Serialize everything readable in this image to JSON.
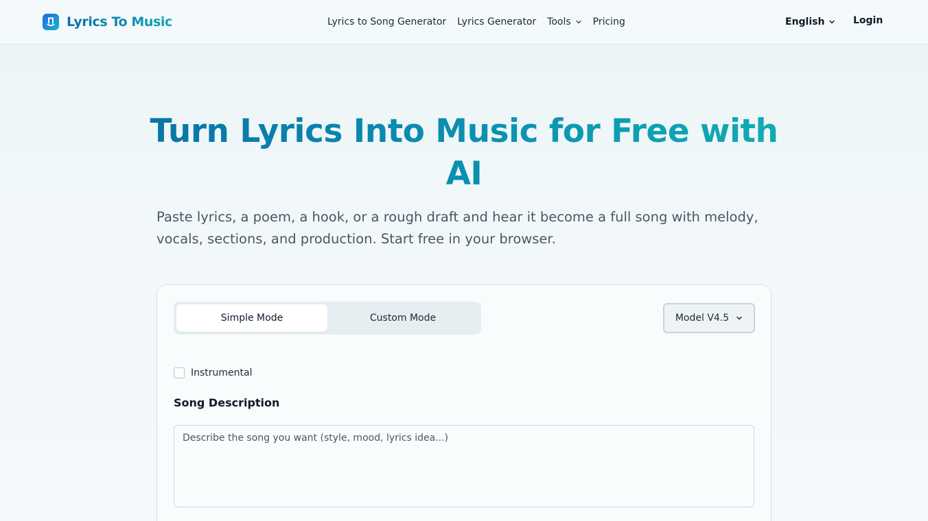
{
  "header": {
    "logo_text": "Lyrics To Music",
    "nav": [
      {
        "label": "Lyrics to Song Generator"
      },
      {
        "label": "Lyrics Generator"
      },
      {
        "label": "Tools"
      },
      {
        "label": "Pricing"
      }
    ],
    "language": "English",
    "login_label": "Login"
  },
  "hero": {
    "title_line1": "Turn Lyrics Into Music for Free with",
    "title_line2": "AI",
    "subtitle": "Paste lyrics, a poem, a hook, or a rough draft and hear it become a full song with melody, vocals, sections, and production. Start free in your browser."
  },
  "form": {
    "modes": [
      {
        "label": "Simple Mode",
        "active": true
      },
      {
        "label": "Custom Mode",
        "active": false
      }
    ],
    "model_label": "Model V4.5",
    "instrumental_label": "Instrumental",
    "instrumental_checked": false,
    "description_label": "Song Description",
    "description_placeholder": "Describe the song you want (style, mood, lyrics idea...)",
    "description_value": ""
  },
  "colors": {
    "brand_start": "#0a67a3",
    "brand_end": "#14b8b4"
  },
  "icons": {
    "logo": "music-note-app-icon",
    "tools_chevron": "chevron-down-icon",
    "language_chevron": "chevron-down-icon",
    "model_chevron": "chevron-down-icon"
  }
}
